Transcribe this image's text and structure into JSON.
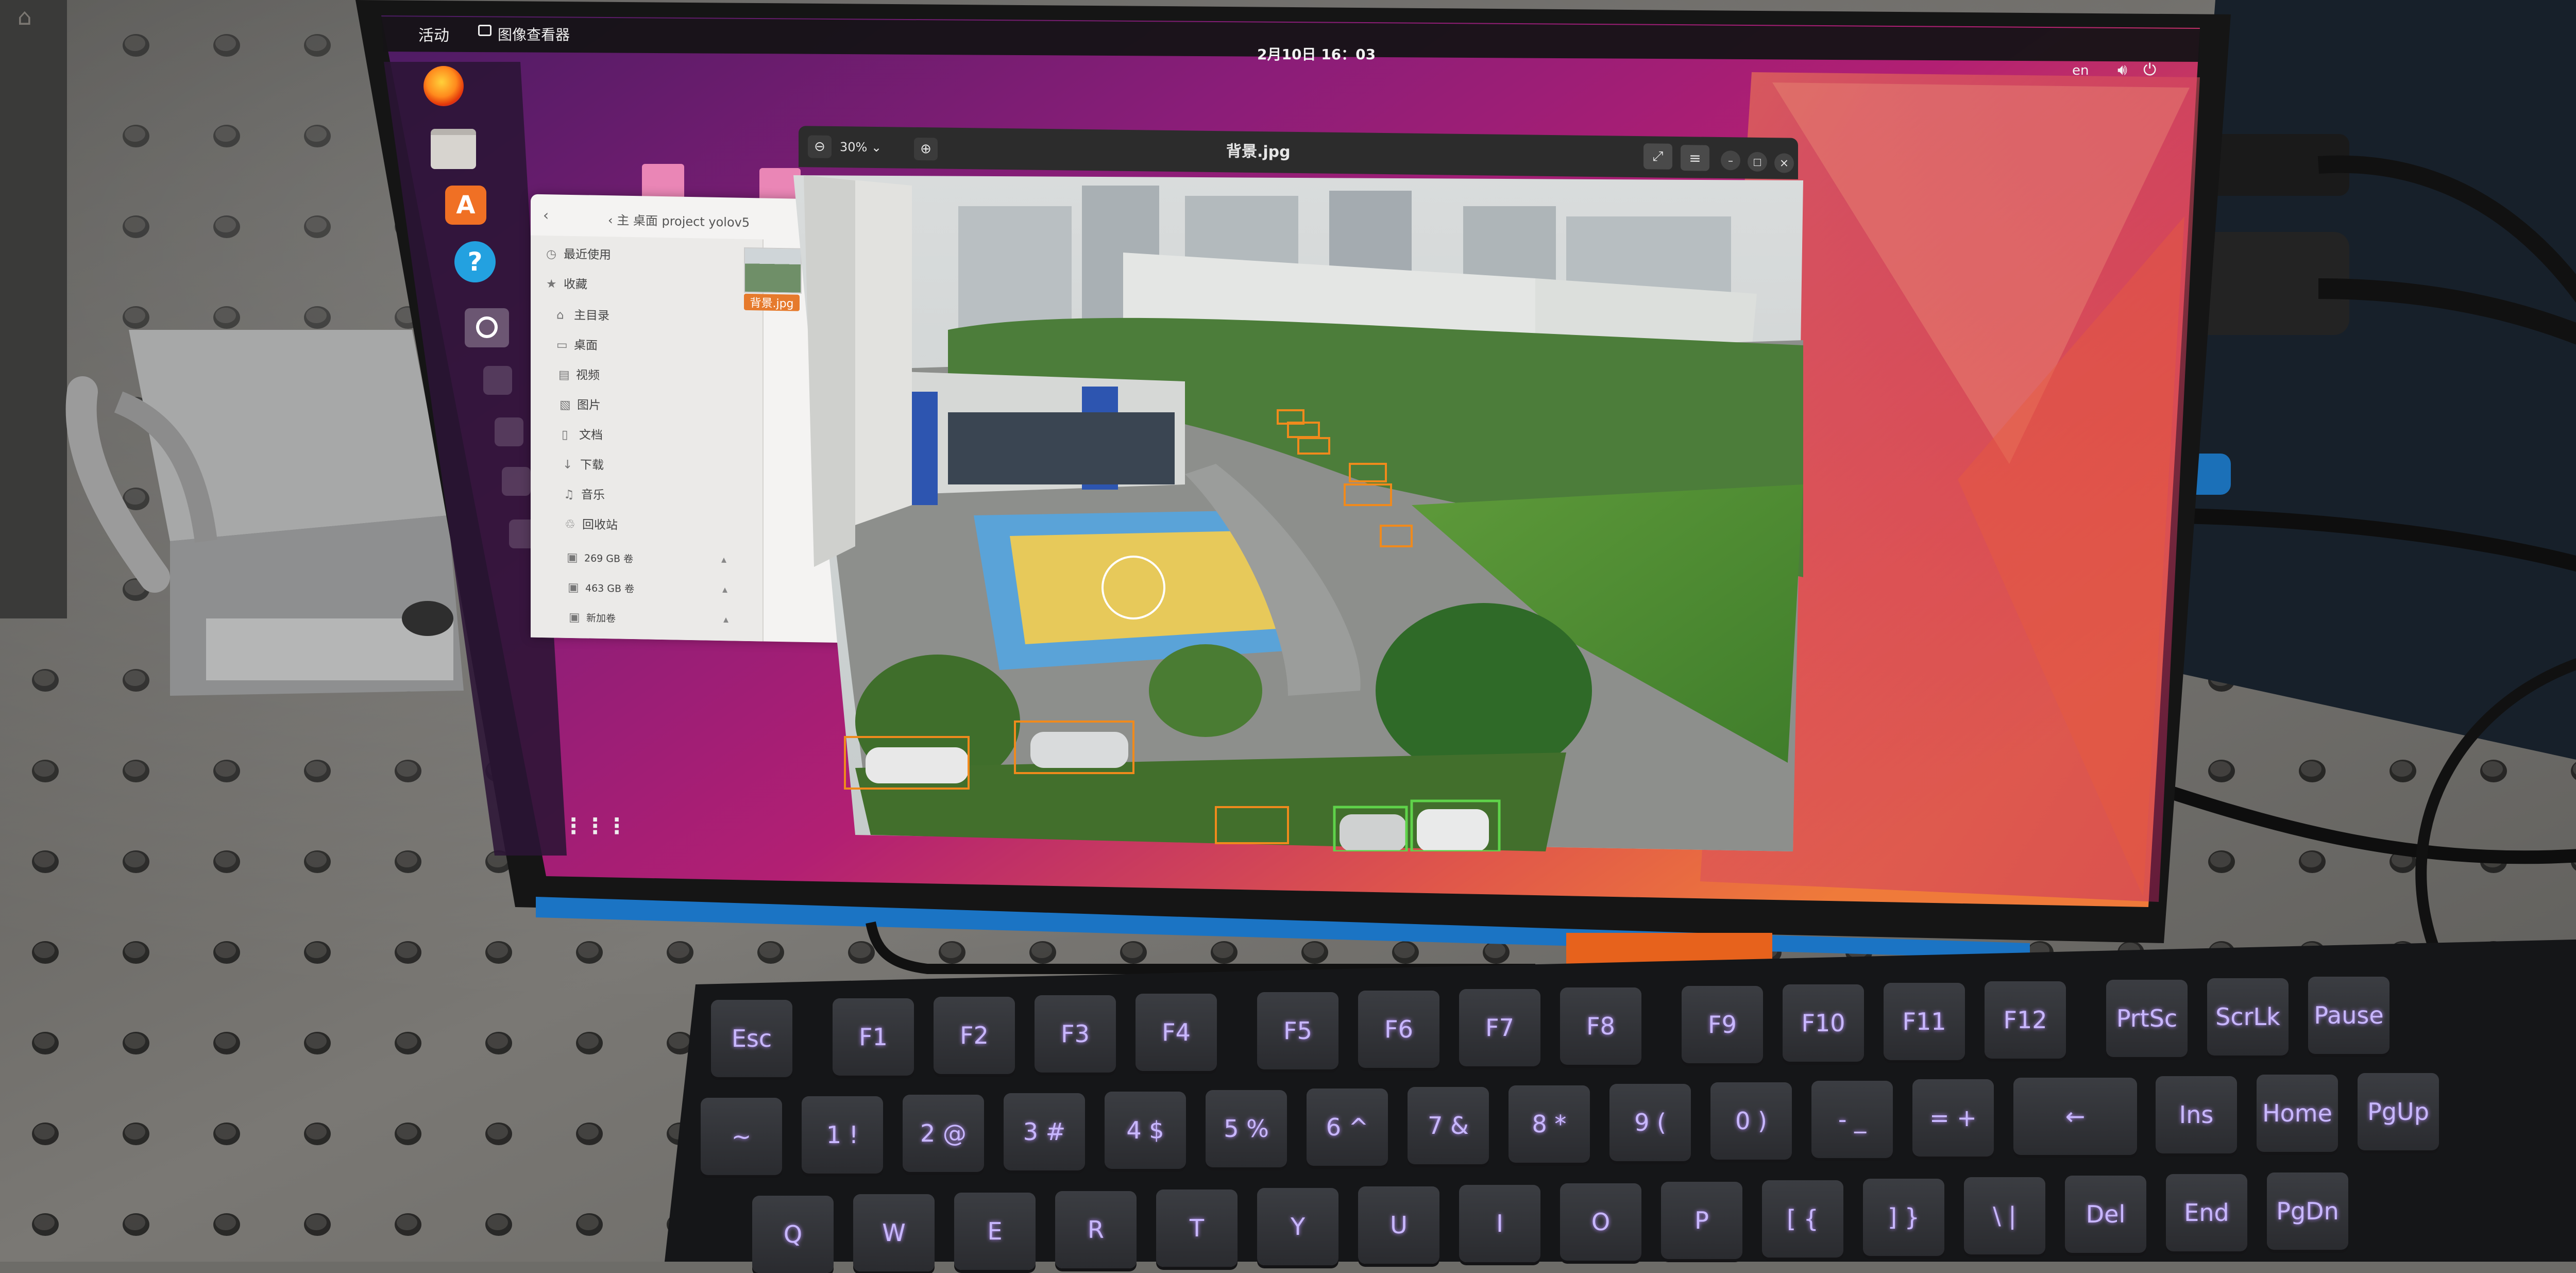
{
  "topbar": {
    "activities": "活动",
    "app_name": "图像查看器",
    "clock": "2月10日 16：03",
    "language": "en",
    "volume_icon": "volume-icon",
    "power_icon": "power-icon"
  },
  "dock": {
    "items": [
      {
        "name": "firefox",
        "icon": "firefox-icon"
      },
      {
        "name": "files",
        "icon": "folder-icon"
      },
      {
        "name": "software",
        "icon": "app-store-icon",
        "glyph": "A"
      },
      {
        "name": "help",
        "icon": "help-icon",
        "glyph": "?"
      },
      {
        "name": "image-viewer",
        "icon": "magnifier-icon"
      }
    ],
    "apps_grid_glyph": "⋮⋮⋮"
  },
  "file_manager": {
    "path": "‹  主  桌面  project  yolov5",
    "sidebar": [
      {
        "icon": "clock-icon",
        "glyph": "◷",
        "label": "最近使用"
      },
      {
        "icon": "star-icon",
        "glyph": "★",
        "label": "收藏"
      },
      {
        "icon": "home-icon",
        "glyph": "⌂",
        "label": "主目录"
      },
      {
        "icon": "desktop-icon",
        "glyph": "▭",
        "label": "桌面"
      },
      {
        "icon": "video-icon",
        "glyph": "▤",
        "label": "视频"
      },
      {
        "icon": "picture-icon",
        "glyph": "▧",
        "label": "图片"
      },
      {
        "icon": "document-icon",
        "glyph": "▯",
        "label": "文档"
      },
      {
        "icon": "download-icon",
        "glyph": "↓",
        "label": "下载"
      },
      {
        "icon": "music-icon",
        "glyph": "♫",
        "label": "音乐"
      },
      {
        "icon": "trash-icon",
        "glyph": "♲",
        "label": "回收站"
      },
      {
        "icon": "drive-icon",
        "glyph": "▣",
        "label": "269 GB 卷"
      },
      {
        "icon": "drive-icon",
        "glyph": "▣",
        "label": "463 GB 卷"
      },
      {
        "icon": "drive-icon",
        "glyph": "▣",
        "label": "新加卷"
      }
    ],
    "file_label": "背景.jpg"
  },
  "viewer": {
    "title": "背景.jpg",
    "zoom": "30% ⌄",
    "zoom_out_glyph": "⊖",
    "zoom_in_glyph": "⊕",
    "fullscreen_glyph": "⤢",
    "menu_glyph": "≡",
    "minimize_glyph": "–",
    "maximize_glyph": "□",
    "close_glyph": "×"
  },
  "keyboard": {
    "row1": [
      "Esc",
      "F1",
      "F2",
      "F3",
      "F4",
      "F5",
      "F6",
      "F7",
      "F8",
      "F9",
      "F10",
      "F11",
      "F12",
      "PrtSc",
      "ScrLk",
      "Pause"
    ],
    "row2": [
      "~",
      "1 !",
      "2 @",
      "3 #",
      "4 $",
      "5 %",
      "6 ^",
      "7 &",
      "8 *",
      "9 (",
      "0 )",
      "- _",
      "= +",
      "←",
      "Ins",
      "Home",
      "PgUp"
    ],
    "row3": [
      "Q",
      "W",
      "E",
      "R",
      "T",
      "Y",
      "U",
      "I",
      "O",
      "P",
      "[ {",
      "] }",
      "\\ |",
      "Del",
      "End",
      "PgDn"
    ]
  },
  "colors": {
    "wallpaper_orange": "#e8683a",
    "wallpaper_magenta": "#b4187a",
    "wallpaper_purple": "#5a1e6e",
    "table_gray": "#6d6c68",
    "detection_orange": "#f08a1c",
    "detection_green": "#5fd34a"
  }
}
